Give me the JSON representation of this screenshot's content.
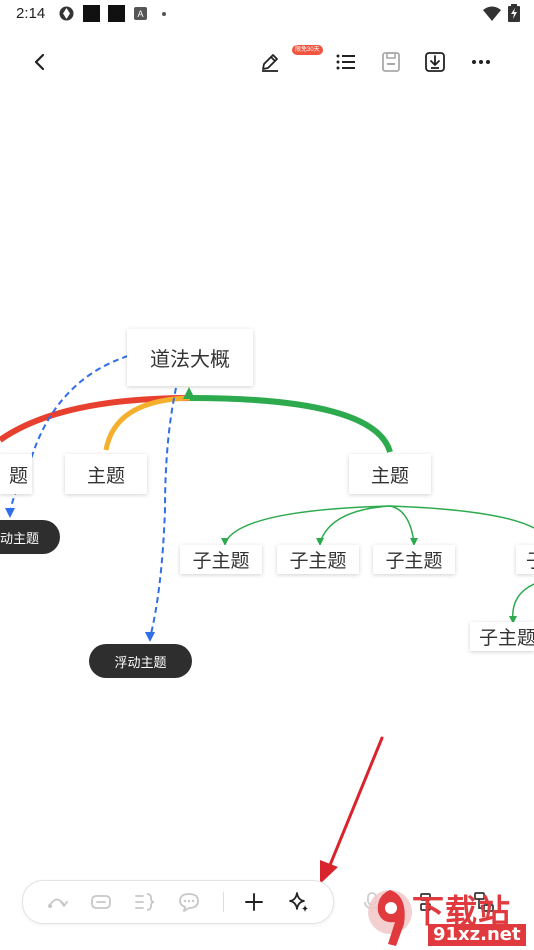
{
  "status_bar": {
    "time": "2:14",
    "icons": [
      "app-icon",
      "black-square-icon",
      "black-square-icon",
      "a-badge-icon",
      "dot-icon",
      "wifi-icon",
      "battery-charging-icon"
    ]
  },
  "toolbar": {
    "back_icon": "chevron-left-icon",
    "pen_icon": "pen-icon",
    "pen_badge": "限免30天",
    "outline_icon": "outline-list-icon",
    "save_icon": "save-icon",
    "download_icon": "download-icon",
    "more_icon": "more-dots-icon"
  },
  "mindmap": {
    "root": "道法大概",
    "topics": [
      "题",
      "主题",
      "主题"
    ],
    "subtopics": [
      "子主题",
      "子主题",
      "子主题",
      "子",
      "子主题"
    ],
    "floating": [
      "动主题",
      "浮动主题"
    ],
    "colors": {
      "red": "#e8402f",
      "orange": "#f4b02d",
      "green": "#2eaa4e",
      "blue_dashed": "#2f6ee8",
      "floating_bg": "#2e2e2e"
    }
  },
  "bottom_toolbar": {
    "items": [
      "undo-icon",
      "text-box-icon",
      "brace-icon",
      "comment-icon",
      "add-icon",
      "ai-sparkle-icon"
    ],
    "extra": [
      "mic-icon",
      "layout-icon",
      "structure-icon"
    ]
  },
  "annotation": {
    "arrow_color": "#d9232d"
  },
  "watermark": {
    "line1": "下载站",
    "line2": "91xz.net"
  }
}
